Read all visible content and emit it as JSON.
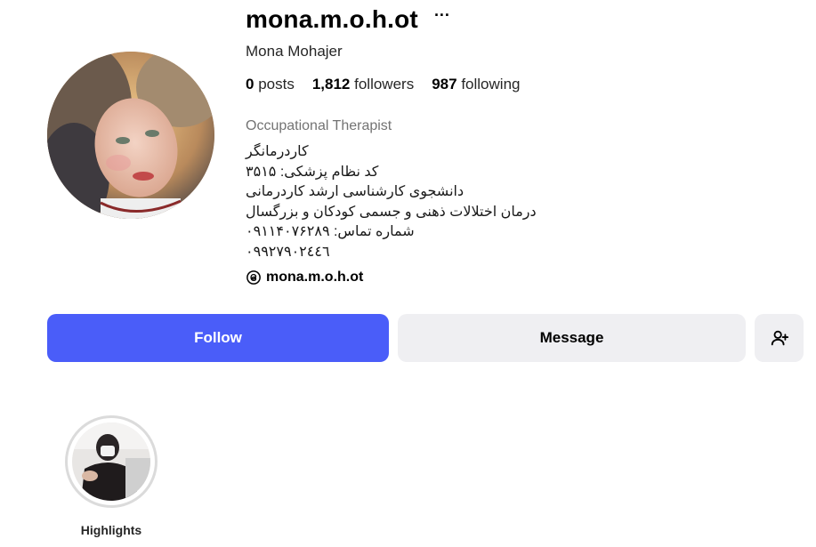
{
  "profile": {
    "username": "mona.m.o.h.ot",
    "more_icon": "ellipsis-icon",
    "more_label": "···",
    "full_name": "Mona Mohajer",
    "stats": {
      "posts_count": "0",
      "posts_label": "posts",
      "followers_count": "1,812",
      "followers_label": "followers",
      "following_count": "987",
      "following_label": "following"
    },
    "category": "Occupational Therapist",
    "bio_lines": [
      "کاردرمانگر",
      "کد نظام پزشکی: ۳۵۱۵",
      "دانشجوی کارشناسی ارشد کاردرمانی",
      "درمان اختلالات ذهنی و جسمی کودکان و بزرگسال",
      "شماره تماس: ۰۹۱۱۴۰۷۶۲۸۹",
      "۰۹۹۲۷۹۰۲٤٤٦"
    ],
    "threads": {
      "icon": "threads-icon",
      "handle": "mona.m.o.h.ot"
    }
  },
  "actions": {
    "follow_label": "Follow",
    "message_label": "Message",
    "add_user_icon": "add-user-icon"
  },
  "highlights": [
    {
      "label": "Highlights"
    }
  ],
  "colors": {
    "follow_button": "#4a5df9",
    "secondary_button": "#efeff2",
    "category_text": "#737373",
    "highlight_ring": "#dbdbdb"
  }
}
